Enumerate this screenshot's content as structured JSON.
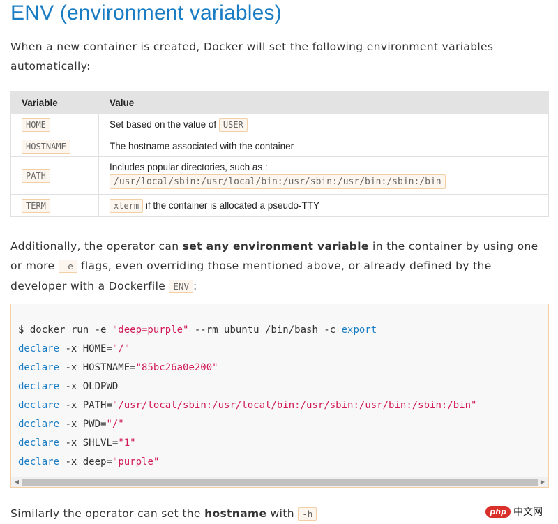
{
  "title": "ENV (environment variables)",
  "intro": "When a new container is created, Docker will set the following environment variables automatically:",
  "table": {
    "headers": [
      "Variable",
      "Value"
    ],
    "rows": [
      {
        "var": "HOME",
        "pre": "Set based on the value of ",
        "code": "USER",
        "post": ""
      },
      {
        "var": "HOSTNAME",
        "pre": "The hostname associated with the container",
        "code": "",
        "post": ""
      },
      {
        "var": "PATH",
        "pre": "Includes popular directories, such as :",
        "code": "/usr/local/sbin:/usr/local/bin:/usr/sbin:/usr/bin:/sbin:/bin",
        "post": ""
      },
      {
        "var": "TERM",
        "pre": "",
        "code": "xterm",
        "post": " if the container is allocated a pseudo-TTY"
      }
    ]
  },
  "additionally": {
    "part1": "Additionally, the operator can ",
    "bold": "set any environment variable",
    "part2": " in the container by using one or more ",
    "code1": "-e",
    "part3": " flags, even overriding those mentioned above, or already defined by the developer with a Dockerfile ",
    "code2": "ENV",
    "part4": ":"
  },
  "code_block": {
    "cmd_prefix": "$ docker run -e ",
    "cmd_str": "\"deep=purple\"",
    "cmd_mid": " --rm ubuntu /bin/bash -c ",
    "cmd_kw": "export",
    "declare_kw": "declare",
    "flag": " -x ",
    "vars": [
      {
        "name": "HOME=",
        "value": "\"/\""
      },
      {
        "name": "HOSTNAME=",
        "value": "\"85bc26a0e200\""
      },
      {
        "name": "OLDPWD",
        "value": ""
      },
      {
        "name": "PATH=",
        "value": "\"/usr/local/sbin:/usr/local/bin:/usr/sbin:/usr/bin:/sbin:/bin\""
      },
      {
        "name": "PWD=",
        "value": "\"/\""
      },
      {
        "name": "SHLVL=",
        "value": "\"1\""
      },
      {
        "name": "deep=",
        "value": "\"purple\""
      }
    ]
  },
  "similarly": {
    "part1": "Similarly the operator can set the ",
    "bold": "hostname",
    "part2": " with ",
    "code": "-h"
  },
  "watermark": {
    "badge": "php",
    "text": "中文网"
  },
  "colors": {
    "title": "#1a7dc4",
    "keyword": "#1a7dc4",
    "string": "#d01a55",
    "inline_border": "#f3cfa6"
  }
}
